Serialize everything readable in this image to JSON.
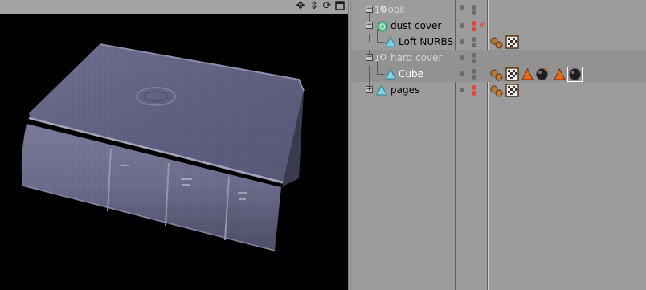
{
  "viewport": {
    "toolbar_icons": [
      "move-icon",
      "zoom-icon",
      "rotate-icon",
      "maximize-icon"
    ]
  },
  "object_manager": {
    "rows": [
      {
        "name": "book",
        "icon": "null-object-icon",
        "state": "collapsed-minus",
        "dimmed": true
      },
      {
        "name": "dust cover",
        "icon": "loft-nurbs-icon",
        "state": "minus",
        "dimmed": false
      },
      {
        "name": "Loft NURBS",
        "icon": "polygon-object-icon",
        "state": "leaf",
        "dimmed": false
      },
      {
        "name": "hard cover",
        "icon": "null-object-icon",
        "state": "minus",
        "dimmed": true
      },
      {
        "name": "Cube",
        "icon": "polygon-object-icon",
        "state": "leaf",
        "dimmed": false,
        "selected": true
      },
      {
        "name": "pages",
        "icon": "polygon-object-icon",
        "state": "plus",
        "dimmed": false
      }
    ],
    "tags": {
      "loft_nurbs": [
        "phong-tag-icon",
        "texture-tag-icon"
      ],
      "cube": [
        "phong-tag-icon",
        "texture-tag-icon",
        "selection-tag-icon",
        "material-tag-icon",
        "selection-tag-icon",
        "material-tag-icon"
      ],
      "pages": [
        "phong-tag-icon",
        "texture-tag-icon"
      ]
    },
    "colors": {
      "panel": "#9c9c9c",
      "row_alt": "#929292",
      "dim_text": "#d2d2d2",
      "visibility_red": "#e0463b"
    }
  }
}
